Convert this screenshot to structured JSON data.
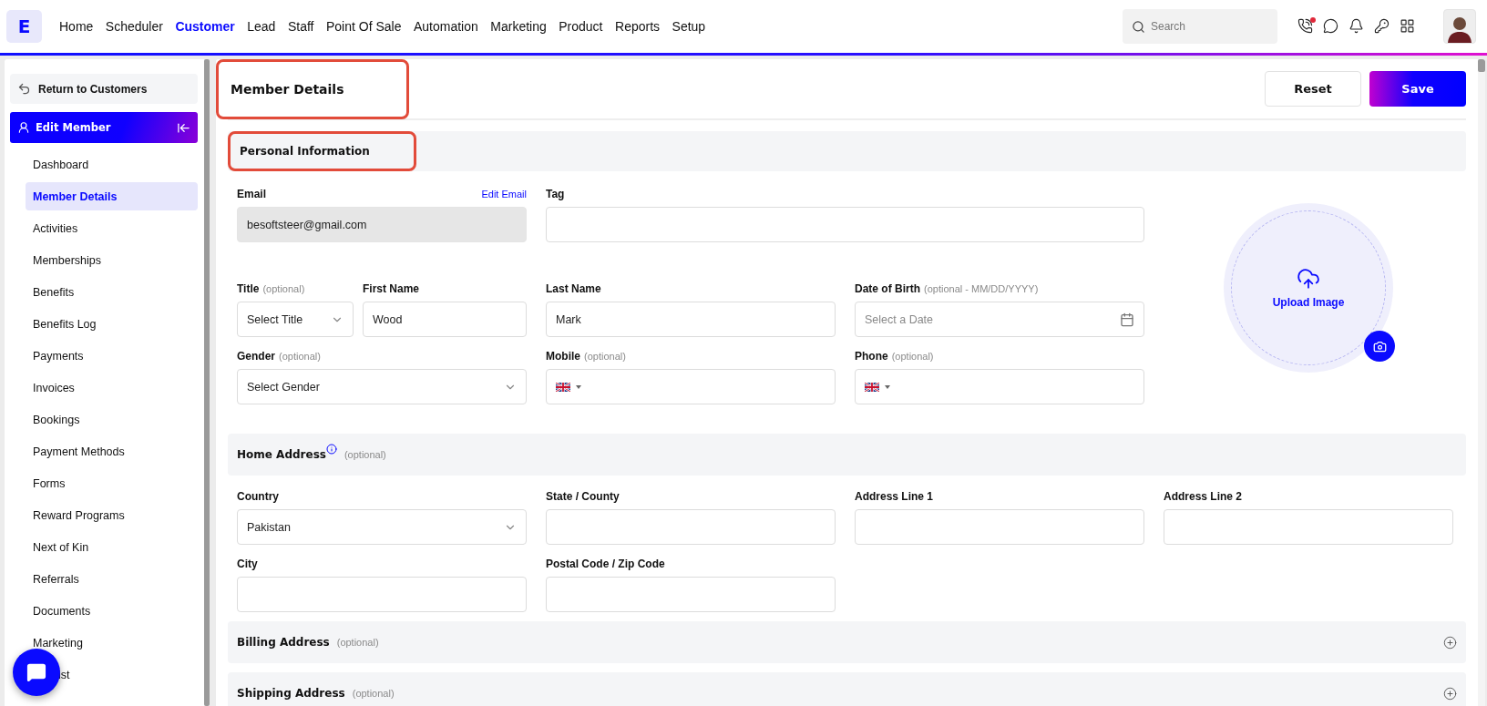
{
  "logo": "E",
  "nav": [
    {
      "label": "Home",
      "selected": false
    },
    {
      "label": "Scheduler",
      "selected": false
    },
    {
      "label": "Customer",
      "selected": true
    },
    {
      "label": "Lead",
      "selected": false
    },
    {
      "label": "Staff",
      "selected": false
    },
    {
      "label": "Point Of Sale",
      "selected": false
    },
    {
      "label": "Automation",
      "selected": false
    },
    {
      "label": "Marketing",
      "selected": false
    },
    {
      "label": "Product",
      "selected": false
    },
    {
      "label": "Reports",
      "selected": false
    },
    {
      "label": "Setup",
      "selected": false
    }
  ],
  "search": {
    "placeholder": "Search"
  },
  "header_icons": [
    {
      "kind": "phone",
      "badge": true
    },
    {
      "kind": "chat",
      "badge": false
    },
    {
      "kind": "bell",
      "badge": false
    },
    {
      "kind": "key",
      "badge": false
    },
    {
      "kind": "grid",
      "badge": false
    }
  ],
  "sidebar": {
    "back": "Return to Customers",
    "section": "Edit Member",
    "items": [
      {
        "label": "Dashboard",
        "selected": false,
        "clipped": false
      },
      {
        "label": "Member Details",
        "selected": true,
        "clipped": false
      },
      {
        "label": "Activities",
        "selected": false,
        "clipped": false
      },
      {
        "label": "Memberships",
        "selected": false,
        "clipped": false
      },
      {
        "label": "Benefits",
        "selected": false,
        "clipped": false
      },
      {
        "label": "Benefits Log",
        "selected": false,
        "clipped": false
      },
      {
        "label": "Payments",
        "selected": false,
        "clipped": false
      },
      {
        "label": "Invoices",
        "selected": false,
        "clipped": false
      },
      {
        "label": "Bookings",
        "selected": false,
        "clipped": false
      },
      {
        "label": "Payment Methods",
        "selected": false,
        "clipped": false
      },
      {
        "label": "Forms",
        "selected": false,
        "clipped": false
      },
      {
        "label": "Reward Programs",
        "selected": false,
        "clipped": false
      },
      {
        "label": "Next of Kin",
        "selected": false,
        "clipped": false
      },
      {
        "label": "Referrals",
        "selected": false,
        "clipped": false
      },
      {
        "label": "Documents",
        "selected": false,
        "clipped": false
      },
      {
        "label": "Marketing",
        "selected": false,
        "clipped": false
      },
      {
        "label": "ist",
        "selected": false,
        "clipped": true
      }
    ]
  },
  "page": {
    "title": "Member Details",
    "highlighted": true,
    "buttons": [
      {
        "label": "Reset",
        "kind": "secondary"
      },
      {
        "label": "Save",
        "kind": "primary"
      }
    ]
  },
  "personal": {
    "title": "Personal Information",
    "highlighted": true,
    "email": {
      "label": "Email",
      "link": "Edit Email",
      "value": "besoftsteer@gmail.com",
      "disabled": true
    },
    "tag": {
      "label": "Tag"
    },
    "upload": {
      "label": "Upload Image"
    },
    "fields": [
      {
        "label": "Title",
        "hint": "(optional)",
        "kind": "select",
        "value": "Select Title"
      },
      {
        "label": "First Name",
        "kind": "text",
        "value": "Wood"
      },
      {
        "label": "Last Name",
        "kind": "text",
        "value": "Mark"
      },
      {
        "label": "Date of Birth",
        "hint": "(optional - MM/DD/YYYY)",
        "kind": "date",
        "placeholder": "Select a Date"
      },
      {
        "label": "Gender",
        "hint": "(optional)",
        "kind": "select",
        "value": "Select Gender"
      },
      {
        "label": "Mobile",
        "hint": "(optional)",
        "kind": "phone"
      },
      {
        "label": "Phone",
        "hint": "(optional)",
        "kind": "phone"
      }
    ]
  },
  "sections": [
    {
      "title": "Home Address",
      "hint": "(optional)",
      "info": true,
      "expanded": true,
      "fields": [
        {
          "label": "Country",
          "kind": "select",
          "value": "Pakistan"
        },
        {
          "label": "State / County",
          "kind": "text"
        },
        {
          "label": "Address Line 1",
          "kind": "text"
        },
        {
          "label": "Address Line 2",
          "kind": "text"
        },
        {
          "label": "City",
          "kind": "text"
        },
        {
          "label": "Postal Code / Zip Code",
          "kind": "text"
        }
      ]
    },
    {
      "title": "Billing Address",
      "hint": "(optional)",
      "info": false,
      "expanded": false
    },
    {
      "title": "Shipping Address",
      "hint": "(optional)",
      "info": false,
      "expanded": false
    }
  ]
}
